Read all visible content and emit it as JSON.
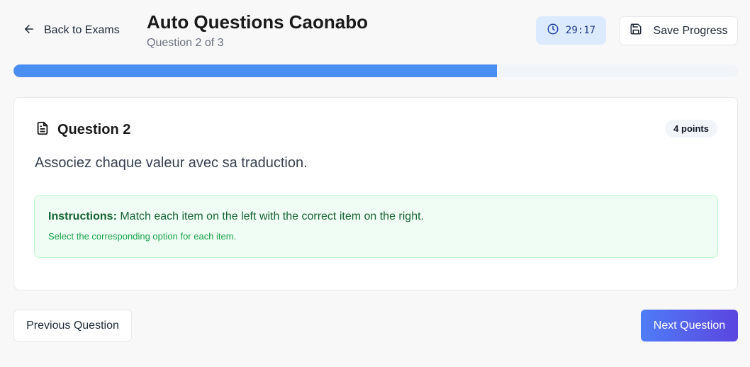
{
  "header": {
    "back_label": "Back to Exams",
    "exam_title": "Auto Questions Caonabo",
    "question_progress": "Question 2 of 3",
    "timer": "29:17",
    "save_label": "Save Progress"
  },
  "progress": {
    "fraction": 0.667,
    "color": "#4b8ef1"
  },
  "question": {
    "title": "Question 2",
    "points": "4 points",
    "text": "Associez chaque valeur avec sa traduction.",
    "instructions": {
      "label": "Instructions:",
      "text": " Match each item on the left with the correct item on the right.",
      "sub": "Select the corresponding option for each item."
    }
  },
  "footer": {
    "prev_label": "Previous Question",
    "next_label": "Next Question"
  },
  "colors": {
    "accent": "#4b8ef1",
    "timer_bg": "#dbeafe",
    "instructions_bg": "#f0fdf4",
    "next_gradient_start": "#4f7cf7",
    "next_gradient_end": "#5b45e0"
  },
  "icons": {
    "back": "arrow-left-icon",
    "timer": "clock-icon",
    "save": "floppy-disk-icon",
    "question": "document-icon"
  }
}
